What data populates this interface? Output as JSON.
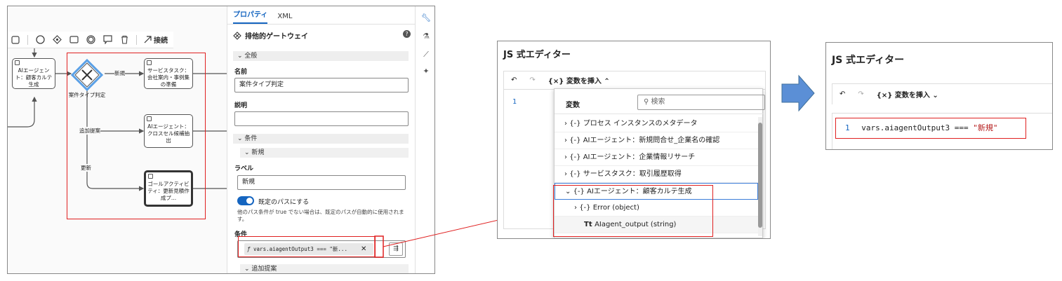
{
  "palette": {
    "connect_label": "接続"
  },
  "diagram": {
    "task1": "AIエージェント：顧客カルテ生成",
    "gateway_label": "案件タイプ判定",
    "task2": "サービスタスク：会社案内・事例集の準備",
    "task3": "AIエージェント：クロスセル候補抽出",
    "task4": "ゴールアクティビティ：更新見積作成プ...",
    "flow_new": "新規",
    "flow_additional": "追加提案",
    "flow_renew": "更新"
  },
  "props": {
    "tabs": [
      "プロパティ",
      "XML"
    ],
    "title": "排他的ゲートウェイ",
    "section_general": "全般",
    "name_label": "名前",
    "name_value": "案件タイプ判定",
    "desc_label": "説明",
    "desc_value": "",
    "section_conditions": "条件",
    "subsection_new": "新規",
    "label_label": "ラベル",
    "label_value": "新規",
    "default_path_label": "既定のパスにする",
    "default_hint": "他のパス条件が true でない場合は、既定のパスが自動的に使用されます。",
    "condition_label": "条件",
    "condition_value": "vars.aiagentOutput3 === \"新...",
    "subsection_additional": "追加提案"
  },
  "js_editor_1": {
    "title": "JS 式エディター",
    "insert_var": "変数を挿入",
    "line_number": "1",
    "dropdown": {
      "header": "変数",
      "search_placeholder": "検索",
      "items": [
        "{-} プロセス インスタンスのメタデータ",
        "{-} AIエージェント：新規問合せ_企業名の確認",
        "{-} AIエージェント：企業情報リサーチ",
        "{-} サービスタスク：取引履歴取得",
        "{-} AIエージェント：顧客カルテ生成",
        "{-} Error (object)",
        "AIagent_output (string)"
      ]
    }
  },
  "js_editor_2": {
    "title": "JS 式エディター",
    "insert_var": "変数を挿入",
    "line_number": "1",
    "code_prefix": "vars.aiagentOutput3 === ",
    "code_string": "\"新規\""
  },
  "colors": {
    "accent": "#1565c0",
    "highlight": "#e02020",
    "arrow": "#5b8fd6"
  }
}
